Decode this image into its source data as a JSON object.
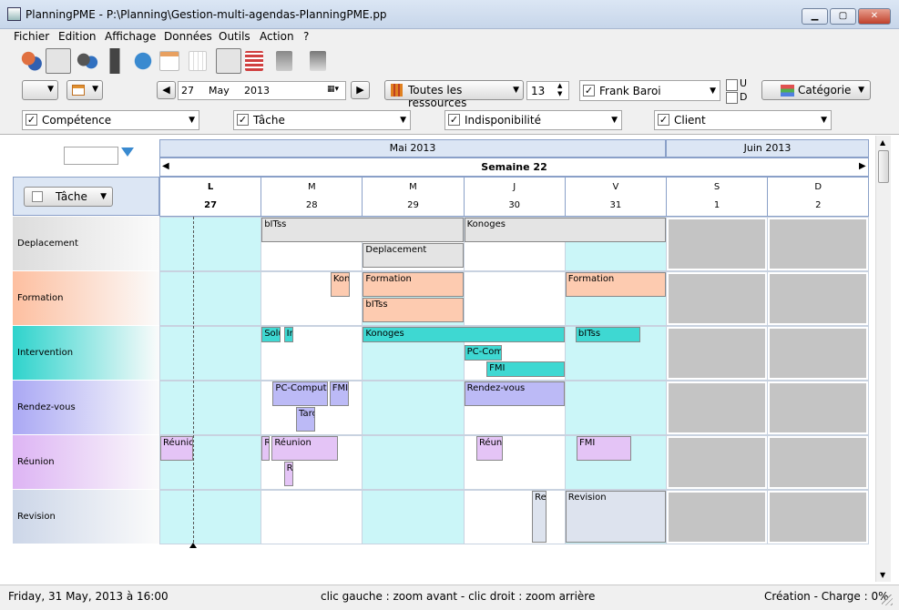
{
  "window": {
    "title": "PlanningPME - P:\\Planning\\Gestion-multi-agendas-PlanningPME.pp"
  },
  "menu": [
    "Fichier",
    "Edition",
    "Affichage",
    "Données",
    "Outils",
    "Action",
    "?"
  ],
  "date": {
    "day": "27",
    "month": "May",
    "year": "2013"
  },
  "resources": {
    "label": "Toutes les ressources",
    "count": "13",
    "user": "Frank Baroi"
  },
  "options": {
    "u": "U",
    "d": "D",
    "category": "Catégorie"
  },
  "filters": [
    "Compétence",
    "Tâche",
    "Indisponibilité",
    "Client"
  ],
  "grid": {
    "months": [
      "Mai 2013",
      "Juin 2013"
    ],
    "week": "Semaine 22",
    "group_button": "Tâche",
    "days": [
      {
        "l": "L",
        "n": "27"
      },
      {
        "l": "M",
        "n": "28"
      },
      {
        "l": "M",
        "n": "29"
      },
      {
        "l": "J",
        "n": "30"
      },
      {
        "l": "V",
        "n": "31"
      },
      {
        "l": "S",
        "n": "1"
      },
      {
        "l": "D",
        "n": "2"
      }
    ],
    "rows": [
      {
        "label": "Deplacement",
        "color": "#dcdcdc"
      },
      {
        "label": "Formation",
        "color": "#fdbfa0"
      },
      {
        "label": "Intervention",
        "color": "#2ed3cc"
      },
      {
        "label": "Rendez-vous",
        "color": "#aaa8f4"
      },
      {
        "label": "Réunion",
        "color": "#ddb4f4"
      },
      {
        "label": "Revision",
        "color": "#ccd6e8"
      }
    ],
    "events": [
      "bITss",
      "Konoges",
      "Deplacement",
      "Kon",
      "Formation",
      "bITss",
      "Formation",
      "Solu",
      "Ir",
      "Konoges",
      "bITss",
      "PC-Com",
      "FMI",
      "PC-Computi",
      "FMI",
      "Tarç",
      "Rendez-vous",
      "Réunio",
      "R",
      "Réunion",
      "R",
      "Réuni",
      "FMI",
      "Re",
      "Revision"
    ]
  },
  "status": {
    "left": "Friday, 31 May, 2013 à 16:00",
    "center": "clic gauche : zoom avant - clic droit : zoom arrière",
    "right": "Création - Charge : 0%"
  }
}
